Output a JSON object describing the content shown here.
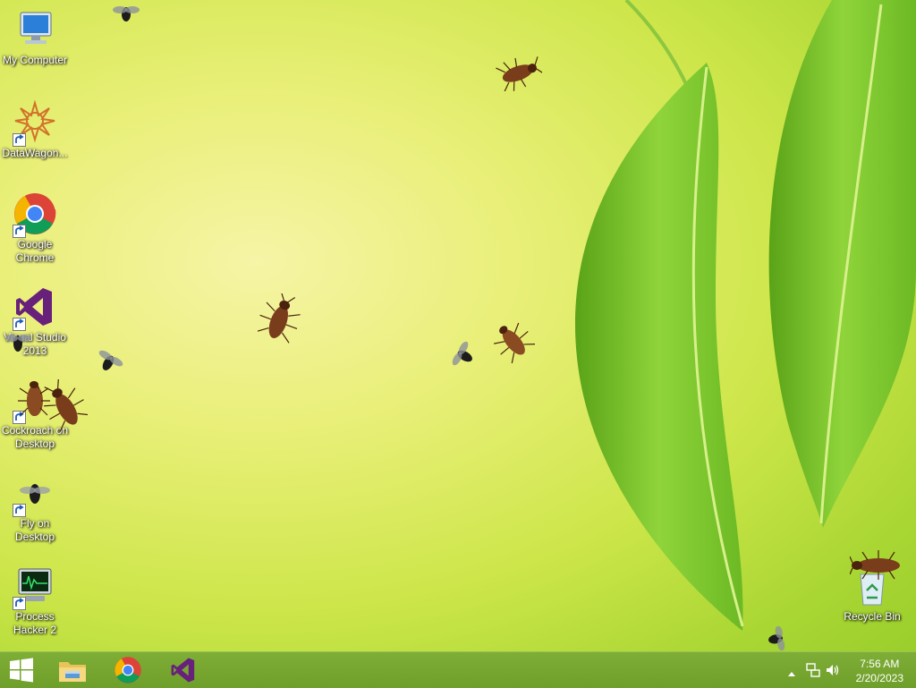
{
  "desktop": {
    "icons": [
      {
        "label": "My Computer"
      },
      {
        "label": "DataWagon..."
      },
      {
        "label": "Google Chrome"
      },
      {
        "label": "Visual Studio 2013"
      },
      {
        "label": "Cockroach on Desktop"
      },
      {
        "label": "Fly on Desktop"
      },
      {
        "label": "Process Hacker 2"
      },
      {
        "label": "Recycle Bin"
      }
    ]
  },
  "taskbar": {
    "start_icon": "windows-logo-icon",
    "pinned": [
      {
        "icon": "file-explorer-icon"
      },
      {
        "icon": "chrome-icon"
      },
      {
        "icon": "visual-studio-icon"
      }
    ],
    "tray": {
      "icons": [
        "show-hidden-icons-chevron",
        "network-icon",
        "volume-icon"
      ],
      "time": "7:56 AM",
      "date": "2/20/2023"
    }
  },
  "colors": {
    "taskbar": "#75a530",
    "wallpaper_light": "#f6f4a6",
    "wallpaper_green": "#9ccf2d"
  }
}
